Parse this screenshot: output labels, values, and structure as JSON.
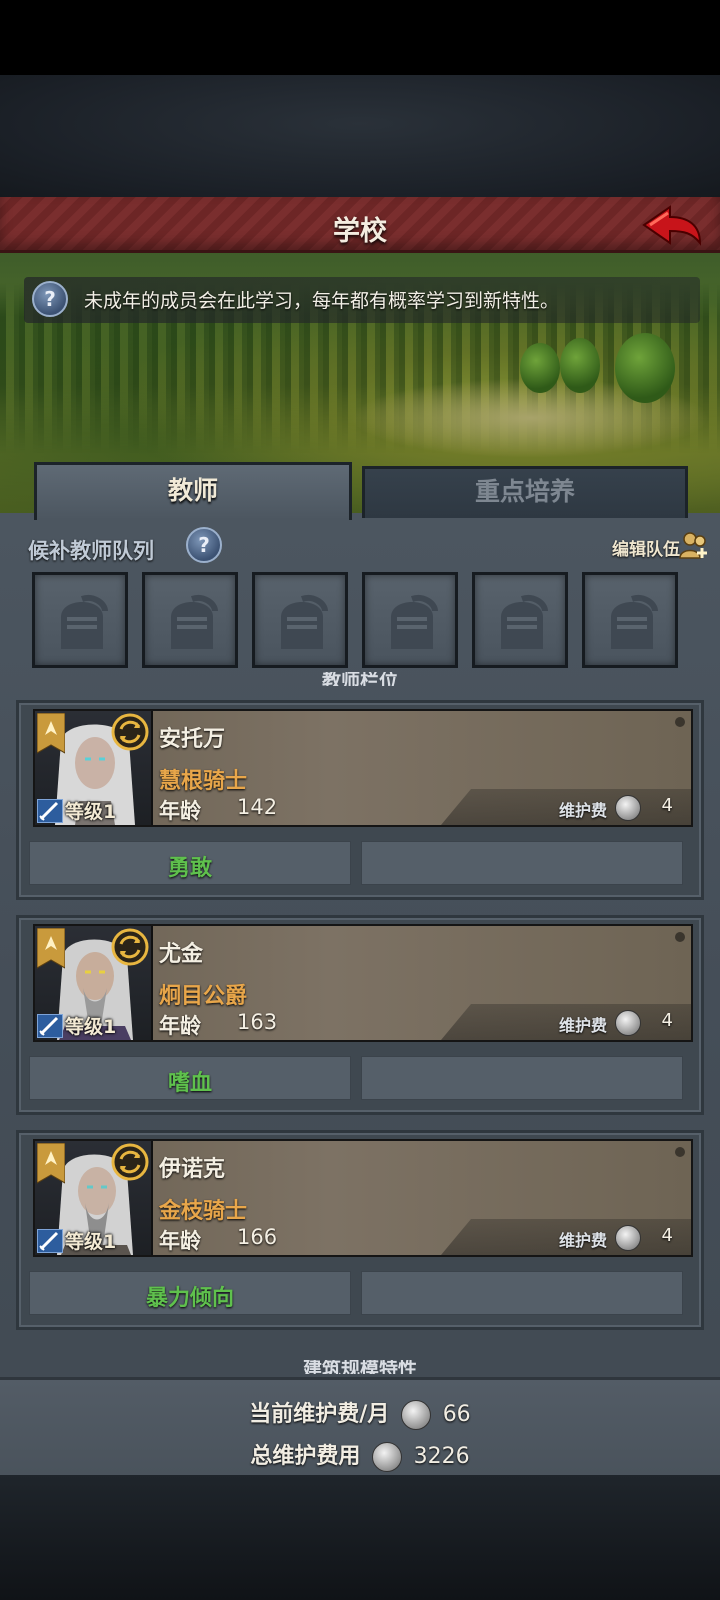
{
  "header": {
    "title": "学校"
  },
  "banner": {
    "info_text": "未成年的成员会在此学习，每年都有概率学习到新特性。"
  },
  "tabs": [
    {
      "label": "教师",
      "active": true
    },
    {
      "label": "重点培养",
      "active": false
    }
  ],
  "candidates": {
    "label": "候补教师队列",
    "edit_label": "编辑队伍",
    "slot_count": 6
  },
  "section_headers": {
    "teacher_slots": "教师栏位",
    "building_traits": "建筑规模特性"
  },
  "teachers": [
    {
      "name": "安托万",
      "title": "慧根骑士",
      "level_label": "等级1",
      "age_label": "年龄",
      "age": "142",
      "upkeep_label": "维护费",
      "upkeep": "4",
      "traits": [
        "勇敢",
        ""
      ]
    },
    {
      "name": "尤金",
      "title": "炯目公爵",
      "level_label": "等级1",
      "age_label": "年龄",
      "age": "163",
      "upkeep_label": "维护费",
      "upkeep": "4",
      "traits": [
        "嗜血",
        ""
      ]
    },
    {
      "name": "伊诺克",
      "title": "金枝骑士",
      "level_label": "等级1",
      "age_label": "年龄",
      "age": "166",
      "upkeep_label": "维护费",
      "upkeep": "4",
      "traits": [
        "暴力倾向",
        ""
      ]
    }
  ],
  "footer": {
    "monthly_label": "当前维护费/月",
    "monthly_value": "66",
    "total_label": "总维护费用",
    "total_value": "3226"
  },
  "colors": {
    "title_red": "#7a2e2e",
    "trait_green": "#5fc14d",
    "title_orange": "#e8a64a",
    "panel_gray": "#4c5660"
  },
  "icons": [
    "back-arrow-icon",
    "help-icon",
    "edit-team-icon",
    "knight-helmet-icon",
    "banner-rank-icon",
    "swap-icon",
    "weapon-sword-icon",
    "silver-coin-icon"
  ]
}
